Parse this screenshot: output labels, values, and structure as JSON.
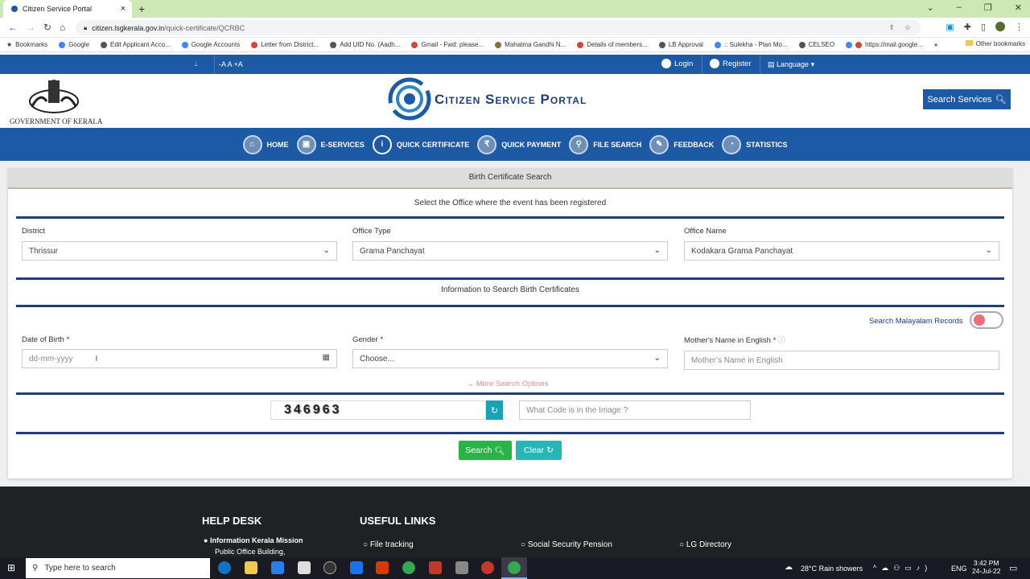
{
  "browser": {
    "tab_title": "Citizen Service Portal",
    "tab_close": "×",
    "new_tab": "+",
    "url_host": "citizen.lsgkerala.gov.in",
    "url_path": "/quick-certificate/QCRBC",
    "bookmarks": [
      "Bookmarks",
      "Google",
      "Edit Applicant Acco...",
      "Google Accounts",
      "Letter from District...",
      "Add UID No. (Aadh...",
      "Gmail - Fwd: please...",
      "Mahatma Gandhi N...",
      "Details of members...",
      "LB Approval",
      ":: Sulekha - Plan Mo...",
      "CELSEO",
      "https://mail.google..."
    ],
    "other_bookmarks": "Other bookmarks"
  },
  "topstrip": {
    "font_controls": "-A  A  +A",
    "login": "Login",
    "register": "Register",
    "language": "Language"
  },
  "header": {
    "govt_label": "GOVERNMENT OF KERALA",
    "portal_name": "Citizen Service Portal",
    "search_services": "Search Services"
  },
  "nav": [
    {
      "label": "HOME",
      "icon": "home-icon"
    },
    {
      "label": "E-SERVICES",
      "icon": "services-icon"
    },
    {
      "label": "QUICK CERTIFICATE",
      "icon": "info-icon"
    },
    {
      "label": "QUICK PAYMENT",
      "icon": "rupee-icon"
    },
    {
      "label": "FILE SEARCH",
      "icon": "search-icon"
    },
    {
      "label": "FEEDBACK",
      "icon": "chat-icon"
    },
    {
      "label": "STATISTICS",
      "icon": "gauge-icon"
    }
  ],
  "form": {
    "card_title": "Birth Certificate Search",
    "office_prompt": "Select the Office where the event has been registered",
    "district_label": "District",
    "district_value": "Thrissur",
    "office_type_label": "Office Type",
    "office_type_value": "Grama Panchayat",
    "office_name_label": "Office Name",
    "office_name_value": "Kodakara Grama Panchayat",
    "info_title": "Information to Search Birth Certificates",
    "malayalam_toggle": "Search Malayalam Records",
    "dob_label": "Date of Birth *",
    "dob_placeholder": "dd-mm-yyyy",
    "gender_label": "Gender *",
    "gender_value": "Choose...",
    "mother_label": "Mother's Name in English *",
    "mother_placeholder": "Mother's Name in English",
    "more_options": "More Search Options",
    "captcha_code": "346963",
    "captcha_placeholder": "What Code is in the Image ?",
    "search_btn": "Search",
    "clear_btn": "Clear"
  },
  "footer": {
    "helpdesk_title": "HELP DESK",
    "helpdesk_org": "Information Kerala Mission",
    "helpdesk_addr": "Public Office Building,",
    "links_title": "USEFUL LINKS",
    "links": [
      "File tracking",
      "Social Security Pension",
      "LG Directory"
    ]
  },
  "taskbar": {
    "search_placeholder": "Type here to search",
    "weather": "28°C  Rain showers",
    "lang": "ENG",
    "time": "3:42 PM",
    "date": "24-Jul-22"
  }
}
